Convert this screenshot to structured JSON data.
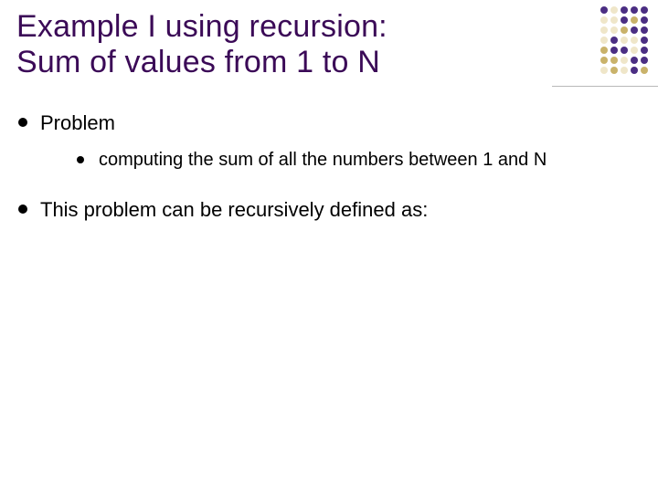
{
  "title_line1": "Example I using recursion:",
  "title_line2": "Sum of values from 1 to N",
  "bullets": {
    "problem": "Problem",
    "problem_sub": "computing the sum of all the numbers between 1 and N",
    "definition": "This problem can be recursively defined as:"
  },
  "decor": {
    "rows": [
      [
        "#4b2e83",
        "#efe6c9",
        "#4b2e83",
        "#4b2e83",
        "#4b2e83"
      ],
      [
        "#efe6c9",
        "#efe6c9",
        "#4b2e83",
        "#c9b26a",
        "#4b2e83"
      ],
      [
        "#efe6c9",
        "#efe6c9",
        "#c9b26a",
        "#4b2e83",
        "#4b2e83"
      ],
      [
        "#efe6c9",
        "#4b2e83",
        "#efe6c9",
        "#efe6c9",
        "#4b2e83"
      ],
      [
        "#c9b26a",
        "#4b2e83",
        "#4b2e83",
        "#efe6c9",
        "#4b2e83"
      ],
      [
        "#c9b26a",
        "#c9b26a",
        "#efe6c9",
        "#4b2e83",
        "#4b2e83"
      ],
      [
        "#efe6c9",
        "#c9b26a",
        "#efe6c9",
        "#4b2e83",
        "#c9b26a"
      ]
    ]
  }
}
